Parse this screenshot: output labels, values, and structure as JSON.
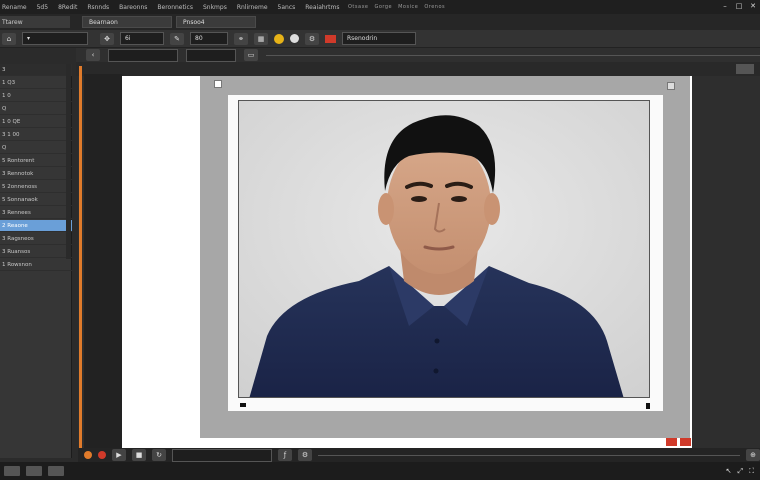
{
  "menu": {
    "items": [
      "Rename",
      "5d5",
      "8Redit",
      "Rsnnds",
      "Bareonns",
      "Beronnetics",
      "Snkmps",
      "Rnlirneme",
      "5ancs",
      "Reaiahrtms"
    ],
    "title_fragments": [
      "Otsaxe",
      "Gorge",
      "Mosice",
      "Orenos"
    ]
  },
  "tabs": {
    "panel_label": "Ttarew",
    "doc_tabs": [
      "Bearnaon",
      "Pnsoo4"
    ]
  },
  "options": {
    "zoom_value": "80",
    "field_label": "Rsenodrin",
    "size_field": "6i"
  },
  "layers": {
    "header": "3",
    "rows": [
      "1 Q3",
      "1 0",
      "Q",
      "1 0 QE",
      "3 1 00",
      "Q",
      "5 Rontorent",
      "3 Rennotok",
      "5 2onnenoss",
      "5 Sonnanaok",
      "3 Rennees",
      "2 Reaone",
      "3 Ragsneos",
      "3 Ruansos",
      "1 Rowsnon"
    ],
    "selected_index": 11
  },
  "colors": {
    "accent_orange": "#e07b2b",
    "selection_blue": "#6a9fd8",
    "shirt_navy": "#1f2a4e",
    "red_marker": "#d03a2a"
  },
  "photo": {
    "description_icon": "portrait-image"
  }
}
